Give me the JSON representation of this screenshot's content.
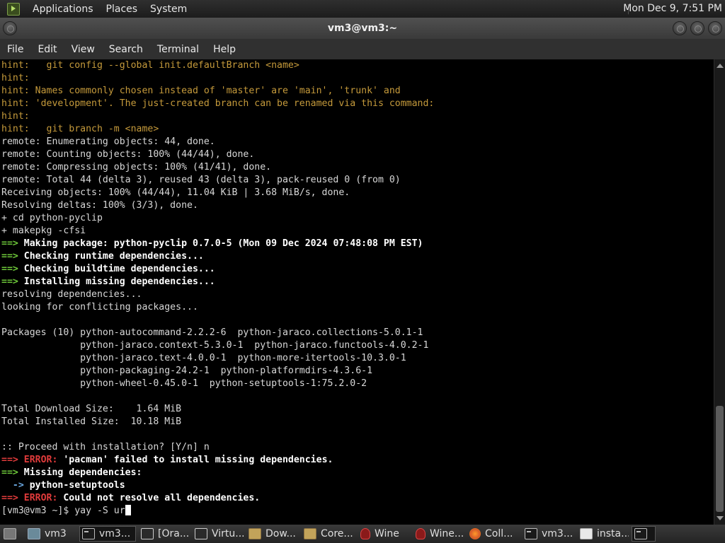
{
  "top_panel": {
    "menus": [
      "Applications",
      "Places",
      "System"
    ],
    "clock": "Mon Dec 9,  7:51 PM"
  },
  "window": {
    "title": "vm3@vm3:~"
  },
  "menubar": [
    "File",
    "Edit",
    "View",
    "Search",
    "Terminal",
    "Help"
  ],
  "terminal": {
    "lines": [
      {
        "segments": [
          {
            "text": "hint:   git config --global init.defaultBranch <name>",
            "style": "hint"
          }
        ]
      },
      {
        "segments": [
          {
            "text": "hint:",
            "style": "hint"
          }
        ]
      },
      {
        "segments": [
          {
            "text": "hint: Names commonly chosen instead of 'master' are 'main', 'trunk' and",
            "style": "hint"
          }
        ]
      },
      {
        "segments": [
          {
            "text": "hint: 'development'. The just-created branch can be renamed via this command:",
            "style": "hint"
          }
        ]
      },
      {
        "segments": [
          {
            "text": "hint:",
            "style": "hint"
          }
        ]
      },
      {
        "segments": [
          {
            "text": "hint:   git branch -m <name>",
            "style": "hint"
          }
        ]
      },
      {
        "segments": [
          {
            "text": "remote: Enumerating objects: 44, done.",
            "style": "plain"
          }
        ]
      },
      {
        "segments": [
          {
            "text": "remote: Counting objects: 100% (44/44), done.",
            "style": "plain"
          }
        ]
      },
      {
        "segments": [
          {
            "text": "remote: Compressing objects: 100% (41/41), done.",
            "style": "plain"
          }
        ]
      },
      {
        "segments": [
          {
            "text": "remote: Total 44 (delta 3), reused 43 (delta 3), pack-reused 0 (from 0)",
            "style": "plain"
          }
        ]
      },
      {
        "segments": [
          {
            "text": "Receiving objects: 100% (44/44), 11.04 KiB | 3.68 MiB/s, done.",
            "style": "plain"
          }
        ]
      },
      {
        "segments": [
          {
            "text": "Resolving deltas: 100% (3/3), done.",
            "style": "plain"
          }
        ]
      },
      {
        "segments": [
          {
            "text": "+ cd python-pyclip",
            "style": "plain"
          }
        ]
      },
      {
        "segments": [
          {
            "text": "+ makepkg -cfsi",
            "style": "plain"
          }
        ]
      },
      {
        "segments": [
          {
            "text": "==> ",
            "style": "green"
          },
          {
            "text": "Making package: python-pyclip 0.7.0-5 (Mon 09 Dec 2024 07:48:08 PM EST)",
            "style": "bold"
          }
        ]
      },
      {
        "segments": [
          {
            "text": "==> ",
            "style": "green"
          },
          {
            "text": "Checking runtime dependencies...",
            "style": "bold"
          }
        ]
      },
      {
        "segments": [
          {
            "text": "==> ",
            "style": "green"
          },
          {
            "text": "Checking buildtime dependencies...",
            "style": "bold"
          }
        ]
      },
      {
        "segments": [
          {
            "text": "==> ",
            "style": "green"
          },
          {
            "text": "Installing missing dependencies...",
            "style": "bold"
          }
        ]
      },
      {
        "segments": [
          {
            "text": "resolving dependencies...",
            "style": "plain"
          }
        ]
      },
      {
        "segments": [
          {
            "text": "looking for conflicting packages...",
            "style": "plain"
          }
        ]
      },
      {
        "segments": [
          {
            "text": "",
            "style": "plain"
          }
        ]
      },
      {
        "segments": [
          {
            "text": "Packages (10) python-autocommand-2.2.2-6  python-jaraco.collections-5.0.1-1",
            "style": "plain"
          }
        ]
      },
      {
        "segments": [
          {
            "text": "              python-jaraco.context-5.3.0-1  python-jaraco.functools-4.0.2-1",
            "style": "plain"
          }
        ]
      },
      {
        "segments": [
          {
            "text": "              python-jaraco.text-4.0.0-1  python-more-itertools-10.3.0-1",
            "style": "plain"
          }
        ]
      },
      {
        "segments": [
          {
            "text": "              python-packaging-24.2-1  python-platformdirs-4.3.6-1",
            "style": "plain"
          }
        ]
      },
      {
        "segments": [
          {
            "text": "              python-wheel-0.45.0-1  python-setuptools-1:75.2.0-2",
            "style": "plain"
          }
        ]
      },
      {
        "segments": [
          {
            "text": "",
            "style": "plain"
          }
        ]
      },
      {
        "segments": [
          {
            "text": "Total Download Size:    1.64 MiB",
            "style": "plain"
          }
        ]
      },
      {
        "segments": [
          {
            "text": "Total Installed Size:  10.18 MiB",
            "style": "plain"
          }
        ]
      },
      {
        "segments": [
          {
            "text": "",
            "style": "plain"
          }
        ]
      },
      {
        "segments": [
          {
            "text": ":: Proceed with installation? [Y/n] n",
            "style": "plain"
          }
        ]
      },
      {
        "segments": [
          {
            "text": "==> ",
            "style": "red"
          },
          {
            "text": "ERROR: ",
            "style": "red"
          },
          {
            "text": "'pacman' failed to install missing dependencies.",
            "style": "bold"
          }
        ]
      },
      {
        "segments": [
          {
            "text": "==> ",
            "style": "green"
          },
          {
            "text": "Missing dependencies:",
            "style": "bold"
          }
        ]
      },
      {
        "segments": [
          {
            "text": "  -> ",
            "style": "blue"
          },
          {
            "text": "python-setuptools",
            "style": "bold"
          }
        ]
      },
      {
        "segments": [
          {
            "text": "==> ",
            "style": "red"
          },
          {
            "text": "ERROR: ",
            "style": "red"
          },
          {
            "text": "Could not resolve all dependencies.",
            "style": "bold"
          }
        ]
      }
    ],
    "prompt": "[vm3@vm3 ~]$ ",
    "input": "yay -S ur"
  },
  "taskbar": {
    "items": [
      {
        "label": "",
        "icon": "show-desktop-icon",
        "kind": "desk",
        "active": false
      },
      {
        "label": "vm3",
        "icon": "home-folder-icon",
        "kind": "home",
        "active": false
      },
      {
        "label": "vm3...",
        "icon": "terminal-icon",
        "kind": "term",
        "active": true
      },
      {
        "label": "[Ora...",
        "icon": "window-icon",
        "kind": "sq",
        "active": false
      },
      {
        "label": "Virtu...",
        "icon": "window-icon",
        "kind": "sq",
        "active": false
      },
      {
        "label": "Dow...",
        "icon": "folder-icon",
        "kind": "folder",
        "active": false
      },
      {
        "label": "Core...",
        "icon": "folder-icon",
        "kind": "folder",
        "active": false
      },
      {
        "label": "Wine",
        "icon": "wine-icon",
        "kind": "wine",
        "active": false
      },
      {
        "label": "Wine...",
        "icon": "wine-icon",
        "kind": "wine",
        "active": false
      },
      {
        "label": "Coll...",
        "icon": "firefox-icon",
        "kind": "fox",
        "active": false
      },
      {
        "label": "vm3...",
        "icon": "terminal-icon",
        "kind": "term",
        "active": false
      },
      {
        "label": "insta...",
        "icon": "text-editor-icon",
        "kind": "edit",
        "active": false
      },
      {
        "label": "",
        "icon": "window-list-icon",
        "kind": "term",
        "active": true
      }
    ]
  }
}
